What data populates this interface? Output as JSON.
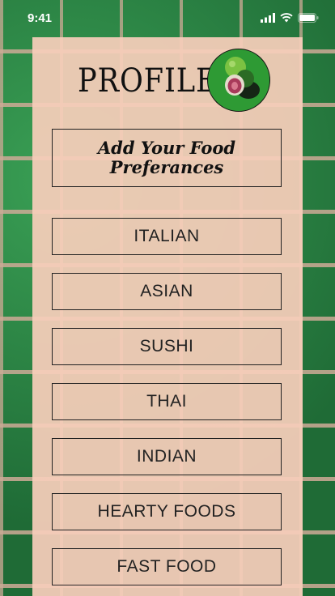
{
  "status_bar": {
    "time": "9:41",
    "icons": [
      "signal-icon",
      "wifi-icon",
      "battery-icon"
    ]
  },
  "header": {
    "title": "PROFILE",
    "avatar_icon": "fig-icon"
  },
  "preferences": {
    "heading": "Add Your Food\nPreferances"
  },
  "food_options": [
    {
      "label": "ITALIAN"
    },
    {
      "label": "ASIAN"
    },
    {
      "label": "SUSHI"
    },
    {
      "label": "THAI"
    },
    {
      "label": "INDIAN"
    },
    {
      "label": "HEARTY FOODS"
    },
    {
      "label": "FAST FOOD"
    }
  ],
  "colors": {
    "panel": "#F6CEBA",
    "avatar_bg": "#2E9A34",
    "brick": "#2F8A45"
  }
}
